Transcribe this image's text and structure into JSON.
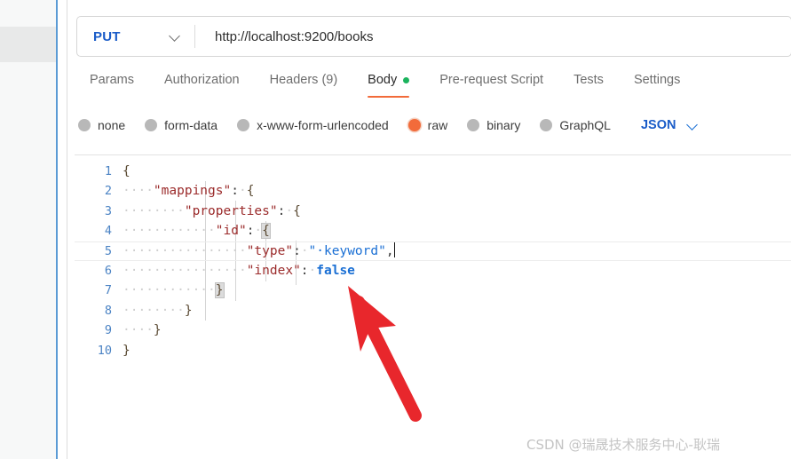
{
  "request": {
    "method": "PUT",
    "method_dropdown_icon": "chevron-down-icon",
    "url": "http://localhost:9200/books",
    "url_placeholder": "Enter request URL"
  },
  "tabs": [
    {
      "label": "Params",
      "active": false
    },
    {
      "label": "Authorization",
      "active": false
    },
    {
      "label": "Headers (9)",
      "active": false
    },
    {
      "label": "Body",
      "active": true,
      "indicator": "green-dot"
    },
    {
      "label": "Pre-request Script",
      "active": false
    },
    {
      "label": "Tests",
      "active": false
    },
    {
      "label": "Settings",
      "active": false
    }
  ],
  "body_types": [
    {
      "label": "none",
      "selected": false
    },
    {
      "label": "form-data",
      "selected": false
    },
    {
      "label": "x-www-form-urlencoded",
      "selected": false
    },
    {
      "label": "raw",
      "selected": true
    },
    {
      "label": "binary",
      "selected": false
    },
    {
      "label": "GraphQL",
      "selected": false
    }
  ],
  "format_select": {
    "label": "JSON",
    "icon": "chevron-down-icon"
  },
  "editor": {
    "line_numbers": [
      "1",
      "2",
      "3",
      "4",
      "5",
      "6",
      "7",
      "8",
      "9",
      "10"
    ],
    "lines": [
      "{",
      "    \"mappings\": {",
      "        \"properties\": {",
      "            \"id\": {",
      "                \"type\": \" keyword\",",
      "                \"index\": false",
      "            }",
      "        }",
      "    }",
      "}"
    ],
    "active_line": "5",
    "caret_line": "5"
  },
  "annotation": {
    "arrow_color": "#e8272c",
    "arrow_name": "red-pointer-arrow"
  },
  "watermark": {
    "text": "CSDN @瑞晟技术服务中心-耿瑞"
  },
  "colors": {
    "accent_orange": "#f26b3a",
    "link_blue": "#1a5cc8",
    "status_green": "#1bb35d",
    "sidebar_bg": "#f7f8f8",
    "divider_blue": "#5b9bd5",
    "json_key": "#9b2b2b",
    "json_string": "#1a6fd4"
  }
}
